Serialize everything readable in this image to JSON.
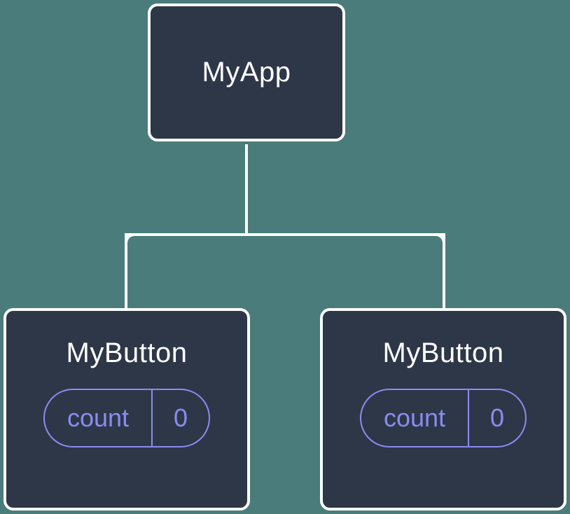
{
  "root": {
    "label": "MyApp"
  },
  "children": [
    {
      "label": "MyButton",
      "state_label": "count",
      "state_value": "0"
    },
    {
      "label": "MyButton",
      "state_label": "count",
      "state_value": "0"
    }
  ]
}
